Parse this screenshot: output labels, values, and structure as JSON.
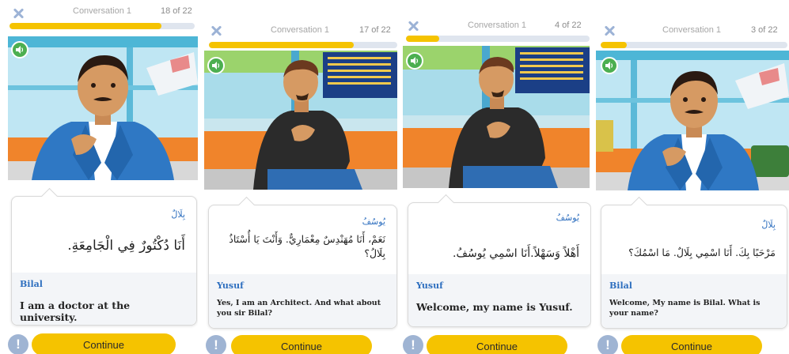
{
  "colors": {
    "accent": "#f5c300",
    "progress_track": "#dfe5ee",
    "name_blue": "#2e6fbf",
    "audio_green": "#4caf50",
    "close_icon": "#9db3d6",
    "help_bubble": "#9fb4d3"
  },
  "icons": {
    "close": "close-icon",
    "audio": "speaker-icon",
    "help": "exclamation-icon"
  },
  "panels": [
    {
      "conversation_label": "Conversation 1",
      "progress_text": "18 of 22",
      "progress": 0.82,
      "arabic_speaker": "بِلَالٌ",
      "arabic_text": "أَنَا دُكْتُورٌ فِي الْجَامِعَةِ.",
      "english_speaker": "Bilal",
      "english_text": "I am a doctor at the university.",
      "continue_label": "Continue",
      "help_label": "!"
    },
    {
      "conversation_label": "Conversation 1",
      "progress_text": "17 of 22",
      "progress": 0.77,
      "arabic_speaker": "يُوسُفُ",
      "arabic_text": "نَعَمْ، أَنَا مُهَنْدِسٌ مِعْمَارِيٌّ. وَأَنْتَ يَا أُسْتَاذُ بِلَالُ؟",
      "english_speaker": "Yusuf",
      "english_text": "Yes, I am an Architect. And what about you sir Bilal?",
      "continue_label": "Continue",
      "help_label": "!"
    },
    {
      "conversation_label": "Conversation 1",
      "progress_text": "4 of 22",
      "progress": 0.18,
      "arabic_speaker": "يُوسُفُ",
      "arabic_text": "أَهْلاً وَسَهْلاً.أَنَا اسْمِي يُوسُفُ.",
      "english_speaker": "Yusuf",
      "english_text": "Welcome, my name is Yusuf.",
      "continue_label": "Continue",
      "help_label": "!"
    },
    {
      "conversation_label": "Conversation 1",
      "progress_text": "3 of 22",
      "progress": 0.14,
      "arabic_speaker": "بِلَالٌ",
      "arabic_text": "مَرْحَبًا بِكَ. أَنَا اسْمِي بِلَالٌ. مَا اسْمُكَ؟",
      "english_speaker": "Bilal",
      "english_text": "Welcome, My name is Bilal. What is your name?",
      "continue_label": "Continue",
      "help_label": "!"
    }
  ]
}
